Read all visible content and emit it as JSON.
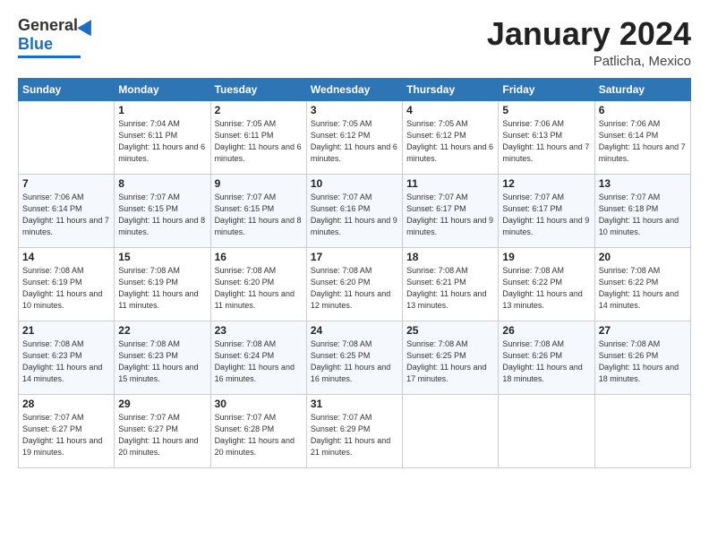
{
  "header": {
    "logo_general": "General",
    "logo_blue": "Blue",
    "title": "January 2024",
    "location": "Patlicha, Mexico"
  },
  "days_of_week": [
    "Sunday",
    "Monday",
    "Tuesday",
    "Wednesday",
    "Thursday",
    "Friday",
    "Saturday"
  ],
  "weeks": [
    [
      {
        "day": "",
        "info": ""
      },
      {
        "day": "1",
        "info": "Sunrise: 7:04 AM\nSunset: 6:11 PM\nDaylight: 11 hours and 6 minutes."
      },
      {
        "day": "2",
        "info": "Sunrise: 7:05 AM\nSunset: 6:11 PM\nDaylight: 11 hours and 6 minutes."
      },
      {
        "day": "3",
        "info": "Sunrise: 7:05 AM\nSunset: 6:12 PM\nDaylight: 11 hours and 6 minutes."
      },
      {
        "day": "4",
        "info": "Sunrise: 7:05 AM\nSunset: 6:12 PM\nDaylight: 11 hours and 6 minutes."
      },
      {
        "day": "5",
        "info": "Sunrise: 7:06 AM\nSunset: 6:13 PM\nDaylight: 11 hours and 7 minutes."
      },
      {
        "day": "6",
        "info": "Sunrise: 7:06 AM\nSunset: 6:14 PM\nDaylight: 11 hours and 7 minutes."
      }
    ],
    [
      {
        "day": "7",
        "info": "Sunrise: 7:06 AM\nSunset: 6:14 PM\nDaylight: 11 hours and 7 minutes."
      },
      {
        "day": "8",
        "info": "Sunrise: 7:07 AM\nSunset: 6:15 PM\nDaylight: 11 hours and 8 minutes."
      },
      {
        "day": "9",
        "info": "Sunrise: 7:07 AM\nSunset: 6:15 PM\nDaylight: 11 hours and 8 minutes."
      },
      {
        "day": "10",
        "info": "Sunrise: 7:07 AM\nSunset: 6:16 PM\nDaylight: 11 hours and 9 minutes."
      },
      {
        "day": "11",
        "info": "Sunrise: 7:07 AM\nSunset: 6:17 PM\nDaylight: 11 hours and 9 minutes."
      },
      {
        "day": "12",
        "info": "Sunrise: 7:07 AM\nSunset: 6:17 PM\nDaylight: 11 hours and 9 minutes."
      },
      {
        "day": "13",
        "info": "Sunrise: 7:07 AM\nSunset: 6:18 PM\nDaylight: 11 hours and 10 minutes."
      }
    ],
    [
      {
        "day": "14",
        "info": "Sunrise: 7:08 AM\nSunset: 6:19 PM\nDaylight: 11 hours and 10 minutes."
      },
      {
        "day": "15",
        "info": "Sunrise: 7:08 AM\nSunset: 6:19 PM\nDaylight: 11 hours and 11 minutes."
      },
      {
        "day": "16",
        "info": "Sunrise: 7:08 AM\nSunset: 6:20 PM\nDaylight: 11 hours and 11 minutes."
      },
      {
        "day": "17",
        "info": "Sunrise: 7:08 AM\nSunset: 6:20 PM\nDaylight: 11 hours and 12 minutes."
      },
      {
        "day": "18",
        "info": "Sunrise: 7:08 AM\nSunset: 6:21 PM\nDaylight: 11 hours and 13 minutes."
      },
      {
        "day": "19",
        "info": "Sunrise: 7:08 AM\nSunset: 6:22 PM\nDaylight: 11 hours and 13 minutes."
      },
      {
        "day": "20",
        "info": "Sunrise: 7:08 AM\nSunset: 6:22 PM\nDaylight: 11 hours and 14 minutes."
      }
    ],
    [
      {
        "day": "21",
        "info": "Sunrise: 7:08 AM\nSunset: 6:23 PM\nDaylight: 11 hours and 14 minutes."
      },
      {
        "day": "22",
        "info": "Sunrise: 7:08 AM\nSunset: 6:23 PM\nDaylight: 11 hours and 15 minutes."
      },
      {
        "day": "23",
        "info": "Sunrise: 7:08 AM\nSunset: 6:24 PM\nDaylight: 11 hours and 16 minutes."
      },
      {
        "day": "24",
        "info": "Sunrise: 7:08 AM\nSunset: 6:25 PM\nDaylight: 11 hours and 16 minutes."
      },
      {
        "day": "25",
        "info": "Sunrise: 7:08 AM\nSunset: 6:25 PM\nDaylight: 11 hours and 17 minutes."
      },
      {
        "day": "26",
        "info": "Sunrise: 7:08 AM\nSunset: 6:26 PM\nDaylight: 11 hours and 18 minutes."
      },
      {
        "day": "27",
        "info": "Sunrise: 7:08 AM\nSunset: 6:26 PM\nDaylight: 11 hours and 18 minutes."
      }
    ],
    [
      {
        "day": "28",
        "info": "Sunrise: 7:07 AM\nSunset: 6:27 PM\nDaylight: 11 hours and 19 minutes."
      },
      {
        "day": "29",
        "info": "Sunrise: 7:07 AM\nSunset: 6:27 PM\nDaylight: 11 hours and 20 minutes."
      },
      {
        "day": "30",
        "info": "Sunrise: 7:07 AM\nSunset: 6:28 PM\nDaylight: 11 hours and 20 minutes."
      },
      {
        "day": "31",
        "info": "Sunrise: 7:07 AM\nSunset: 6:29 PM\nDaylight: 11 hours and 21 minutes."
      },
      {
        "day": "",
        "info": ""
      },
      {
        "day": "",
        "info": ""
      },
      {
        "day": "",
        "info": ""
      }
    ]
  ]
}
